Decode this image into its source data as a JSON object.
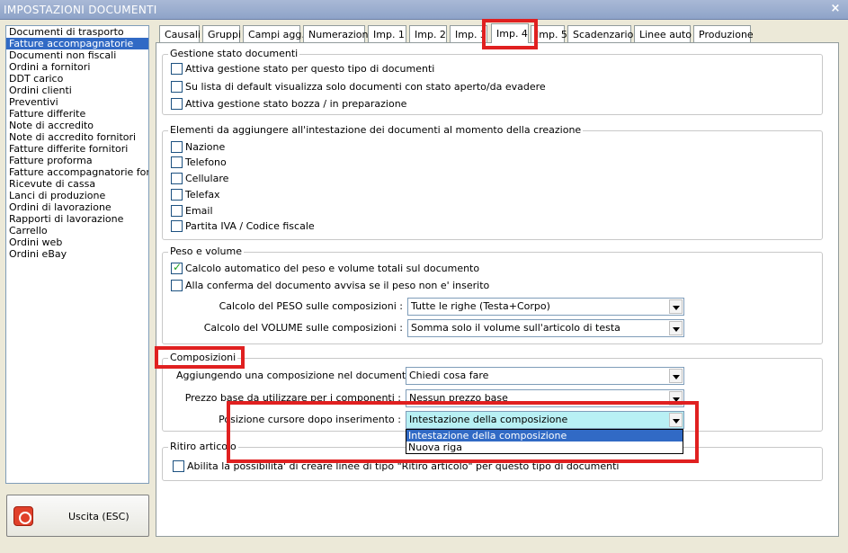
{
  "window": {
    "title": "IMPOSTAZIONI DOCUMENTI",
    "close": "×"
  },
  "doc_list": {
    "selected_index": 1,
    "items": [
      "Documenti di trasporto",
      "Fatture accompagnatorie",
      "Documenti non fiscali",
      "Ordini a fornitori",
      "DDT carico",
      "Ordini clienti",
      "Preventivi",
      "Fatture differite",
      "Note di accredito",
      "Note di accredito fornitori",
      "Fatture differite fornitori",
      "Fatture proforma",
      "Fatture accompagnatorie fornito",
      "Ricevute di cassa",
      "Lanci di produzione",
      "Ordini di lavorazione",
      "Rapporti di lavorazione",
      "Carrello",
      "Ordini web",
      "Ordini eBay"
    ]
  },
  "exit": {
    "label": "Uscita (ESC)"
  },
  "tabs": [
    "Causali",
    "Gruppi",
    "Campi agg.",
    "Numerazioni",
    "Imp. 1",
    "Imp. 2",
    "Imp. 3",
    "Imp. 4",
    "Imp. 5",
    "Scadenzario",
    "Linee auto",
    "Produzione"
  ],
  "active_tab": "Imp. 4",
  "g1": {
    "title": "Gestione stato documenti",
    "c1": "Attiva gestione stato per questo tipo di documenti",
    "c2": "Su lista di default visualizza solo documenti con stato aperto/da evadere",
    "c3": "Attiva gestione stato bozza / in preparazione"
  },
  "g2": {
    "title": "Elementi da aggiungere all'intestazione dei documenti al momento della creazione",
    "c1": "Nazione",
    "c2": "Telefono",
    "c3": "Cellulare",
    "c4": "Telefax",
    "c5": "Email",
    "c6": "Partita IVA / Codice fiscale"
  },
  "g3": {
    "title": "Peso e volume",
    "c1": "Calcolo automatico del peso e volume totali sul documento",
    "c1_checked": true,
    "c2": "Alla conferma del documento avvisa se il peso non e' inserito",
    "peso_label": "Calcolo del PESO sulle composizioni :",
    "peso_value": "Tutte le righe (Testa+Corpo)",
    "vol_label": "Calcolo del VOLUME sulle composizioni :",
    "vol_value": "Somma solo il volume sull'articolo di testa"
  },
  "g4": {
    "title": "Composizioni",
    "agg_label": "Aggiungendo una composizione nel documento :",
    "agg_value": "Chiedi cosa fare",
    "prezzo_label": "Prezzo base da utilizzare per i componenti :",
    "prezzo_value": "Nessun prezzo base",
    "pos_label": "Posizione cursore dopo inserimento :",
    "pos_value": "Intestazione della composizione",
    "pos_options": [
      "Intestazione della composizione",
      "Nuova riga"
    ]
  },
  "g5": {
    "title": "Ritiro articolo",
    "c1": "Abilita la possibilita' di creare linee di tipo \"Ritiro articolo\" per questo tipo di documenti"
  }
}
